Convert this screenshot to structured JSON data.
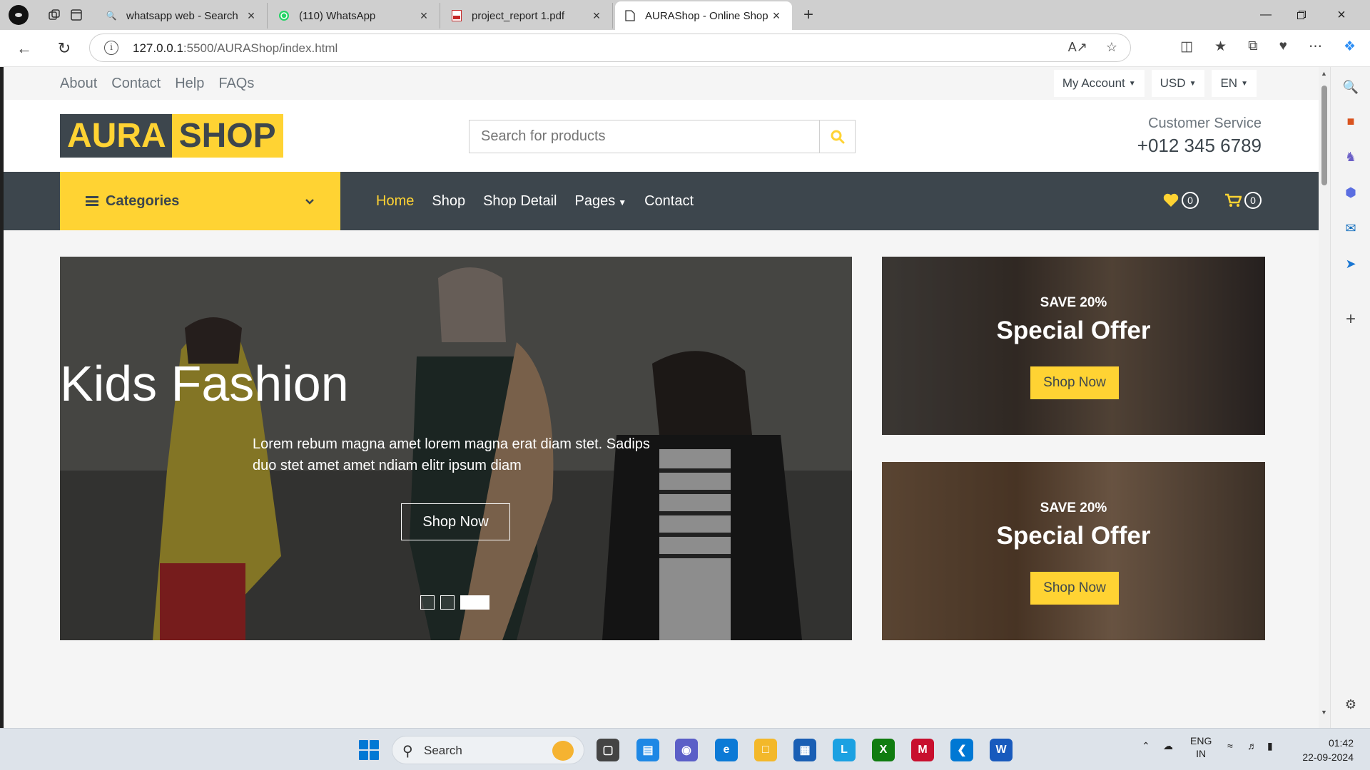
{
  "browser": {
    "tabs": [
      {
        "title": "whatsapp web - Search",
        "icon": "search-icon"
      },
      {
        "title": "(110) WhatsApp",
        "icon": "whatsapp-icon"
      },
      {
        "title": "project_report 1.pdf",
        "icon": "pdf-icon"
      },
      {
        "title": "AURAShop - Online Shop Website",
        "icon": "page-icon"
      }
    ],
    "url_host": "127.0.0.1",
    "url_rest": ":5500/AURAShop/index.html"
  },
  "topbar": {
    "links": [
      "About",
      "Contact",
      "Help",
      "FAQs"
    ],
    "account": "My Account",
    "currency": "USD",
    "language": "EN"
  },
  "header": {
    "logo_part1": "AURA",
    "logo_part2": "SHOP",
    "search_placeholder": "Search for products",
    "cs_label": "Customer Service",
    "cs_phone": "+012 345 6789"
  },
  "nav": {
    "categories": "Categories",
    "items": [
      "Home",
      "Shop",
      "Shop Detail",
      "Pages",
      "Contact"
    ],
    "wishlist_count": "0",
    "cart_count": "0"
  },
  "hero": {
    "title": "Kids Fashion",
    "text": "Lorem rebum magna amet lorem magna erat diam stet. Sadips duo stet amet amet ndiam elitr ipsum diam",
    "button": "Shop Now",
    "slide_count": 3,
    "active_slide": 3
  },
  "offers": [
    {
      "save": "SAVE 20%",
      "title": "Special Offer",
      "button": "Shop Now"
    },
    {
      "save": "SAVE 20%",
      "title": "Special Offer",
      "button": "Shop Now"
    }
  ],
  "taskbar": {
    "search_label": "Search",
    "lang_1": "ENG",
    "lang_2": "IN",
    "time": "01:42",
    "date": "22-09-2024"
  },
  "colors": {
    "accent": "#ffd333",
    "dark": "#3d464d",
    "muted": "#6c757d"
  }
}
